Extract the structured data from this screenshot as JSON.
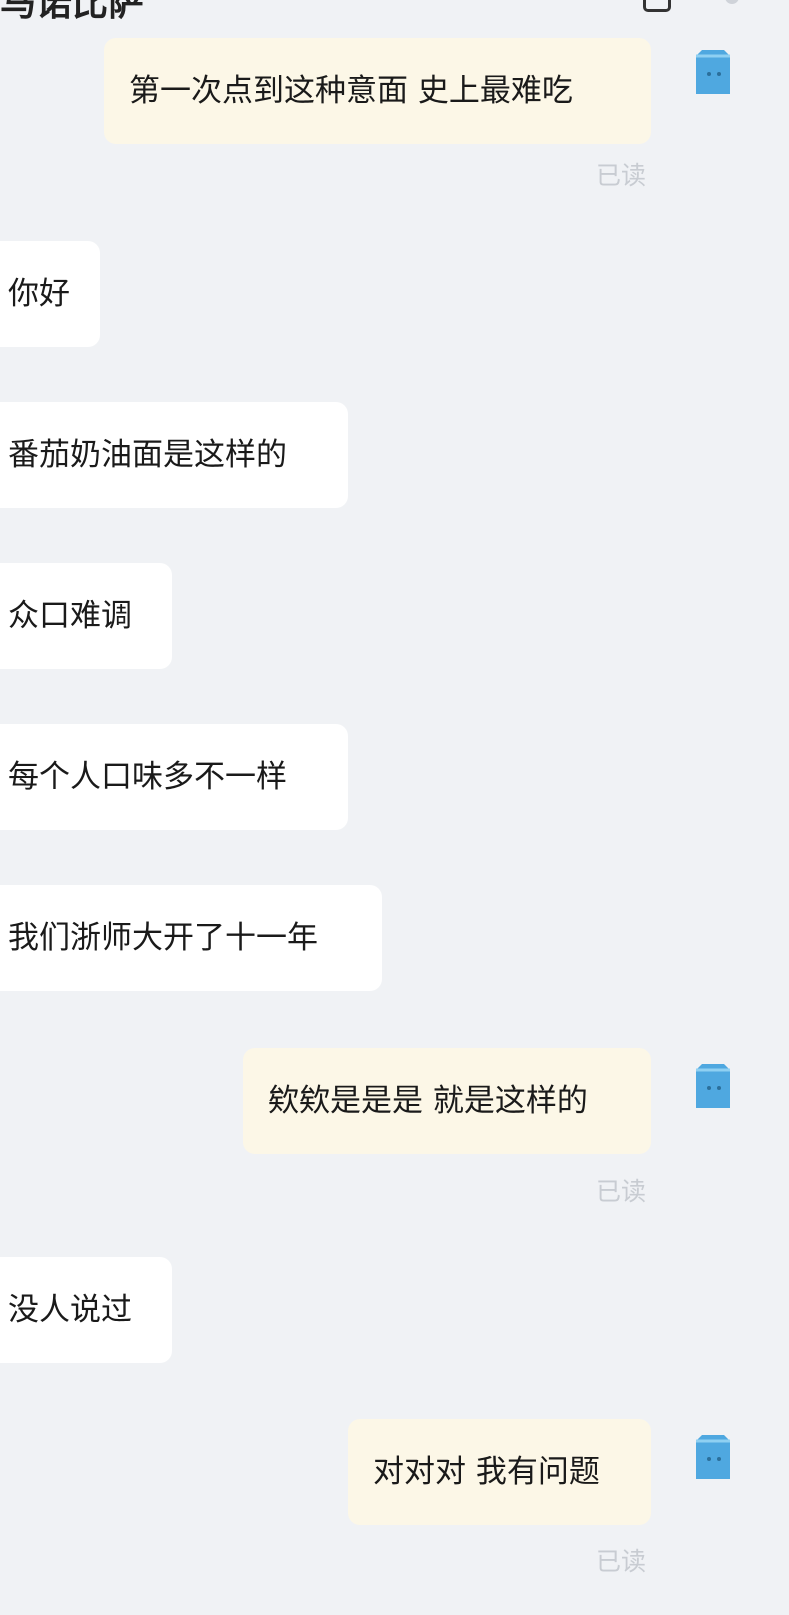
{
  "header": {
    "title": "马诺比萨"
  },
  "colors": {
    "background": "#f0f2f5",
    "incoming_bubble": "#ffffff",
    "outgoing_bubble": "#fcf7e7",
    "read_status": "#c8ccd2",
    "avatar": "#4fa8e0"
  },
  "messages": [
    {
      "direction": "out",
      "text": "第一次点到这种意面 史上最难吃",
      "status": "已读"
    },
    {
      "direction": "in",
      "text": "你好"
    },
    {
      "direction": "in",
      "text": "番茄奶油面是这样的"
    },
    {
      "direction": "in",
      "text": "众口难调"
    },
    {
      "direction": "in",
      "text": "每个人口味多不一样"
    },
    {
      "direction": "in",
      "text": "我们浙师大开了十一年"
    },
    {
      "direction": "out",
      "text": "欸欸是是是 就是这样的",
      "status": "已读"
    },
    {
      "direction": "in",
      "text": "没人说过"
    },
    {
      "direction": "out",
      "text": "对对对 我有问题",
      "status": "已读"
    }
  ]
}
